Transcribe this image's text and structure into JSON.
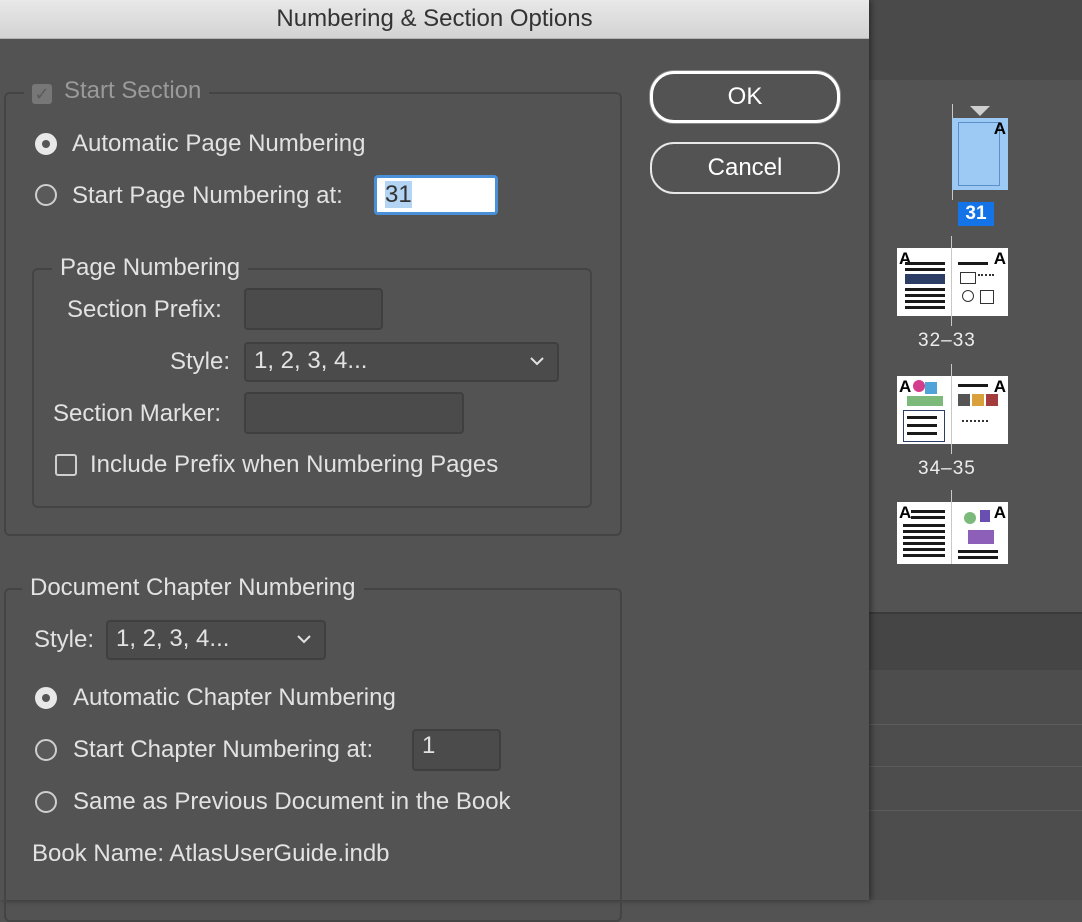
{
  "dialog": {
    "title": "Numbering & Section Options",
    "ok_label": "OK",
    "cancel_label": "Cancel"
  },
  "section": {
    "start_section_label": "Start Section",
    "start_section_checked": true,
    "auto_page_numbering_label": "Automatic Page Numbering",
    "start_page_numbering_label": "Start Page Numbering at:",
    "start_page_value": "31"
  },
  "page_numbering": {
    "legend": "Page Numbering",
    "section_prefix_label": "Section Prefix:",
    "section_prefix_value": "",
    "style_label": "Style:",
    "style_value": "1, 2, 3, 4...",
    "section_marker_label": "Section Marker:",
    "section_marker_value": "",
    "include_prefix_label": "Include Prefix when Numbering Pages"
  },
  "chapter_numbering": {
    "legend": "Document Chapter Numbering",
    "style_label": "Style:",
    "style_value": "1, 2, 3, 4...",
    "auto_chapter_label": "Automatic Chapter Numbering",
    "start_chapter_label": "Start Chapter Numbering at:",
    "start_chapter_value": "1",
    "same_as_previous_label": "Same as Previous Document in the Book",
    "book_name_label": "Book Name: AtlasUserGuide.indb"
  },
  "pages_panel": {
    "labels": [
      "31",
      "32–33",
      "34–35"
    ],
    "master_letter": "A",
    "selected_color": "#1473e6"
  }
}
